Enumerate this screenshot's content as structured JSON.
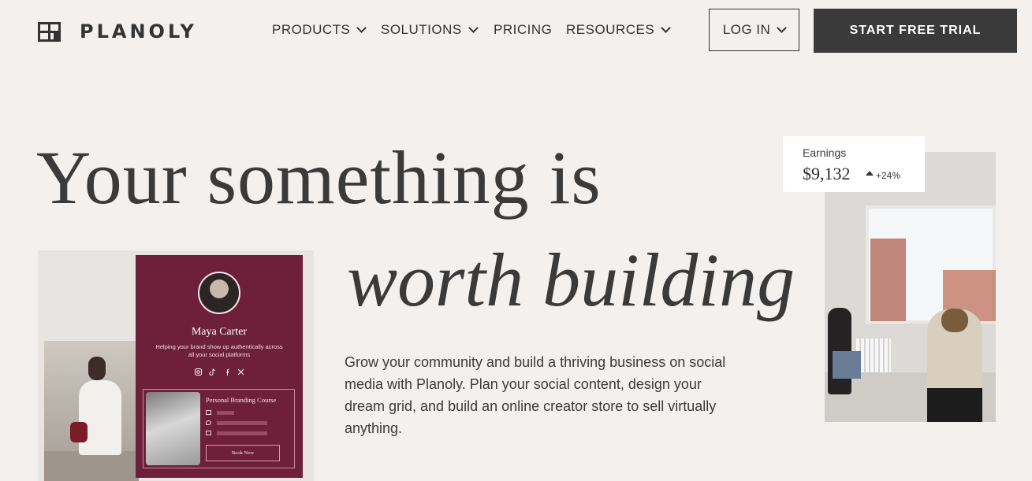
{
  "brand": {
    "name": "PLANOLY"
  },
  "nav": {
    "items": [
      {
        "label": "PRODUCTS",
        "dropdown": true
      },
      {
        "label": "SOLUTIONS",
        "dropdown": true
      },
      {
        "label": "PRICING",
        "dropdown": false
      },
      {
        "label": "RESOURCES",
        "dropdown": true
      }
    ],
    "login_label": "LOG IN",
    "cta_label": "START FREE TRIAL"
  },
  "hero": {
    "headline_line1": "Your something is",
    "headline_line2": "worth building",
    "description": "Grow your community and build a thriving business on social media with Planoly. Plan your social content, design your dream grid, and build an online creator store to sell virtually anything."
  },
  "profile_card": {
    "name": "Maya Carter",
    "bio": "Helping your brand show up authentically across all your social platforms",
    "course_title": "Personal Branding Course",
    "button_label": "Book Now",
    "socials": [
      "instagram-icon",
      "tiktok-icon",
      "facebook-icon",
      "x-icon"
    ]
  },
  "earnings": {
    "label": "Earnings",
    "value": "$9,132",
    "change": "+24%"
  },
  "colors": {
    "background": "#f3f0ee",
    "cta": "#3a3a3a",
    "card": "#6e1f3a"
  }
}
